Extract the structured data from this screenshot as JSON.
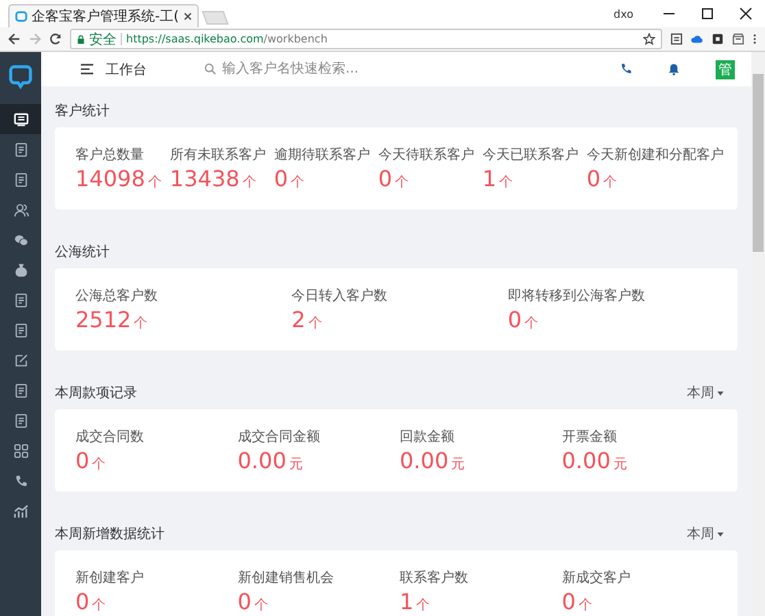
{
  "browser": {
    "tab_title": "企客宝客户管理系统-工(",
    "user": "dxo",
    "security": "安全",
    "url_host": "https://saas.qikebao.com",
    "url_path": "/workbench"
  },
  "sidebar": {
    "items": [
      {
        "selected": true
      },
      {
        "selected": false
      },
      {
        "selected": false
      },
      {
        "selected": false
      },
      {
        "selected": false
      },
      {
        "selected": false
      },
      {
        "selected": false
      },
      {
        "selected": false
      },
      {
        "selected": false
      },
      {
        "selected": false
      },
      {
        "selected": false
      },
      {
        "selected": false
      },
      {
        "selected": false
      },
      {
        "selected": false
      }
    ]
  },
  "header": {
    "title": "工作台",
    "search": {
      "placeholder": "输入客户名快速检索..."
    },
    "avatar_text": "管"
  },
  "sections": [
    {
      "title": "客户统计",
      "stats": [
        {
          "label": "客户总数量",
          "value": "14098",
          "unit": "个"
        },
        {
          "label": "所有未联系客户",
          "value": "13438",
          "unit": "个"
        },
        {
          "label": "逾期待联系客户",
          "value": "0",
          "unit": "个"
        },
        {
          "label": "今天待联系客户",
          "value": "0",
          "unit": "个"
        },
        {
          "label": "今天已联系客户",
          "value": "1",
          "unit": "个"
        },
        {
          "label": "今天新创建和分配客户",
          "value": "0",
          "unit": "个"
        }
      ]
    },
    {
      "title": "公海统计",
      "stats": [
        {
          "label": "公海总客户数",
          "value": "2512",
          "unit": "个"
        },
        {
          "label": "今日转入客户数",
          "value": "2",
          "unit": "个"
        },
        {
          "label": "即将转移到公海客户数",
          "value": "0",
          "unit": "个"
        }
      ]
    },
    {
      "title": "本周款项记录",
      "filter": "本周",
      "stats": [
        {
          "label": "成交合同数",
          "value": "0",
          "unit": "个"
        },
        {
          "label": "成交合同金额",
          "value": "0.00",
          "unit": "元"
        },
        {
          "label": "回款金额",
          "value": "0.00",
          "unit": "元"
        },
        {
          "label": "开票金额",
          "value": "0.00",
          "unit": "元"
        }
      ]
    },
    {
      "title": "本周新增数据统计",
      "filter": "本周",
      "stats": [
        {
          "label": "新创建客户",
          "value": "0",
          "unit": "个"
        },
        {
          "label": "新创建销售机会",
          "value": "0",
          "unit": "个"
        },
        {
          "label": "联系客户数",
          "value": "1",
          "unit": "个"
        },
        {
          "label": "新成交客户",
          "value": "0",
          "unit": "个"
        }
      ]
    }
  ]
}
